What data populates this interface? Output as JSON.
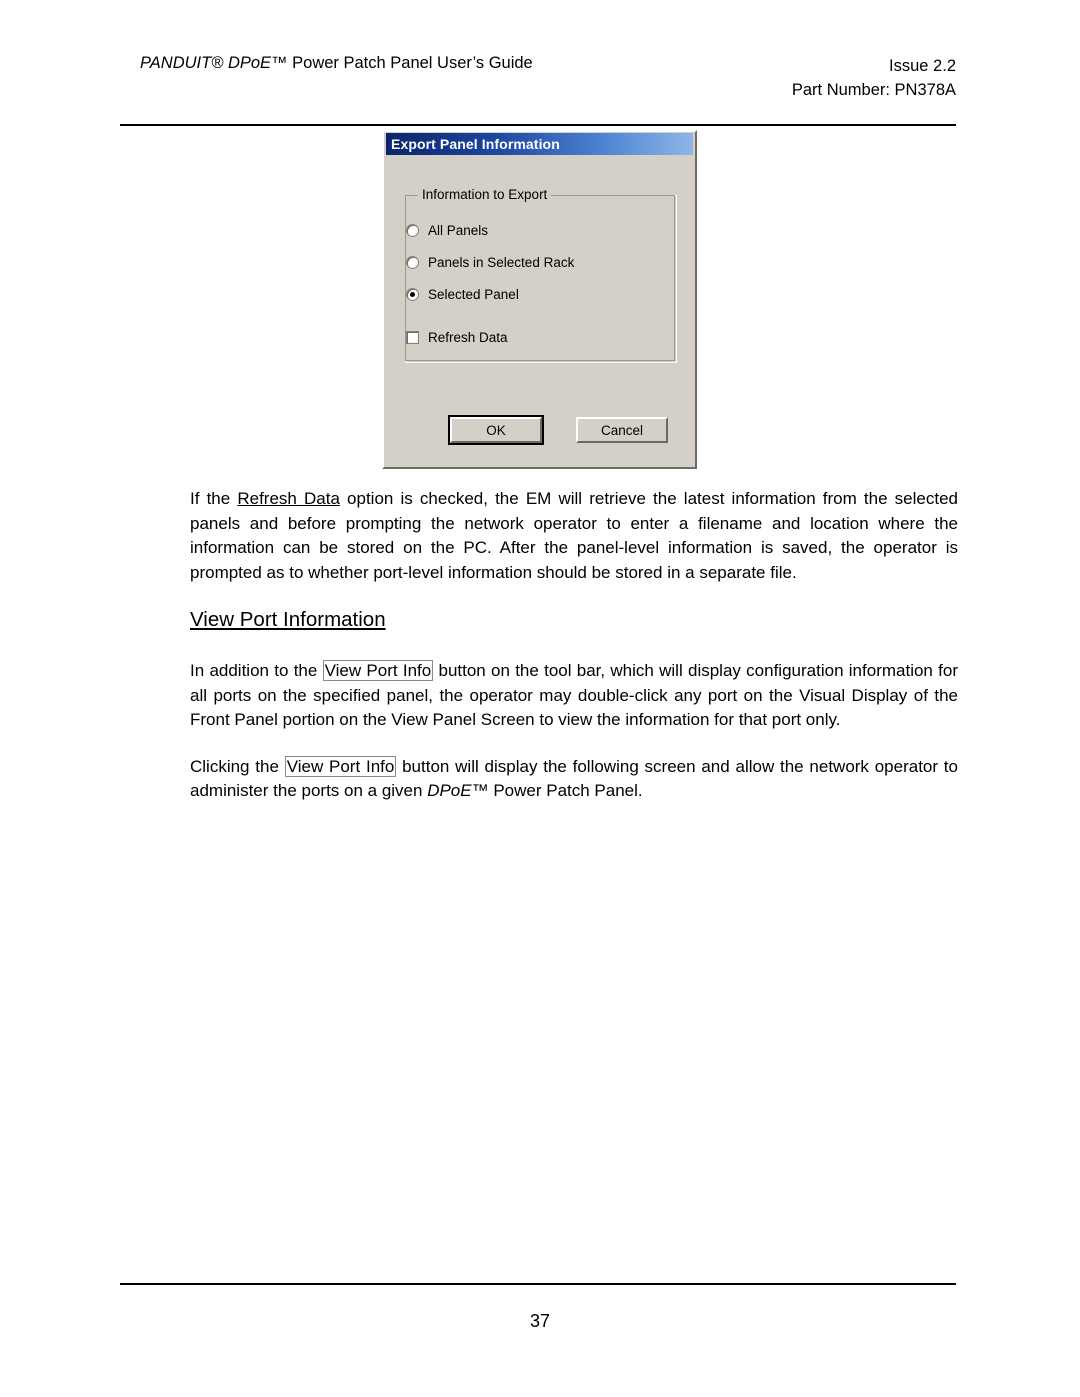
{
  "header": {
    "left_title_italic": "PANDUIT® DPoE™",
    "left_title_rest": " Power Patch Panel User’s Guide",
    "issue": "Issue 2.2",
    "part_number": "Part Number: PN378A"
  },
  "dialog": {
    "title": "Export Panel Information",
    "groupbox_legend": "Information to Export",
    "options": [
      {
        "label": "All Panels",
        "type": "radio",
        "checked": false
      },
      {
        "label": "Panels in Selected Rack",
        "type": "radio",
        "checked": false
      },
      {
        "label": "Selected Panel",
        "type": "radio",
        "checked": true
      },
      {
        "label": "Refresh Data",
        "type": "checkbox",
        "checked": false
      }
    ],
    "ok_label": "OK",
    "cancel_label": "Cancel",
    "titlebar_color_start": "#0a246a",
    "titlebar_color_end": "#8fb6e8",
    "face_color": "#d4d0c8"
  },
  "content": {
    "para1_a": "If the ",
    "para1_underlined": "Refresh Data",
    "para1_b": " option is checked, the EM will retrieve the latest information from the selected panels and before prompting the network operator to enter a filename and location where the information can be stored on the PC.  After the panel-level information is saved, the operator is prompted as to whether port-level information should be stored in a separate file.",
    "heading": "View Port Information",
    "para2_a": "In addition to the ",
    "para2_boxed": "View Port Info",
    "para2_b": " button on the tool bar, which will display configuration information for all ports on the specified panel, the operator may double-click any port on the Visual Display of the Front Panel portion on the View Panel Screen to view the information for that port only.",
    "para3_a": "Clicking the ",
    "para3_boxed": "View Port Info",
    "para3_b": " button will display the following screen and allow the network operator to administer the ports on a given ",
    "para3_italic": "DPoE™",
    "para3_c": " Power Patch Panel."
  },
  "footer": {
    "page_number": "37"
  }
}
